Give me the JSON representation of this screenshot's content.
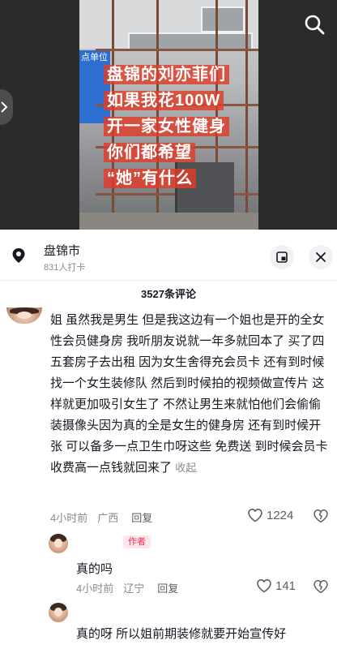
{
  "video": {
    "overlay_lines": [
      "盘锦的刘亦菲们",
      "如果我花100W",
      "开一家女性健身",
      "你们都希望",
      "“她”有什么"
    ],
    "sign_text": "点单位",
    "overlay_bg": "#e13c28"
  },
  "location": {
    "name": "盘锦市",
    "checkins": "831人打卡",
    "pin_icon": "location-pin-icon",
    "pip_icon": "picture-in-picture-icon",
    "close_icon": "close-icon"
  },
  "comments_header": "3527条评论",
  "comments": [
    {
      "text": "姐 虽然我是男生 但是我这边有一个姐也是开的全女性会员健身房 我听朋友说就一年多就回本了 买了四五套房子去出租 因为女生舍得充会员卡  还有到时候找一个女生装修队 然后到时候拍的视频做宣传片 这样就更加吸引女生了 不然让男生来就怕他们会偷偷装摄像头因为真的全是女生的健身房  还有到时候开张 可以备多一点卫生巾呀这些 免费送 到时候会员卡收费高一点钱就回来了",
      "collapse_label": "收起",
      "time": "4小时前",
      "region": "广西",
      "reply_label": "回复",
      "likes": "1224"
    },
    {
      "badge": "作者",
      "text": "真的吗",
      "time": "4小时前",
      "region": "辽宁",
      "reply_label": "回复",
      "likes": "141"
    },
    {
      "text": "真的呀  所以姐前期装修就要开始宣传好"
    }
  ],
  "colors": {
    "accent": "#fe2c55",
    "meta_gray": "#8a8b91"
  }
}
